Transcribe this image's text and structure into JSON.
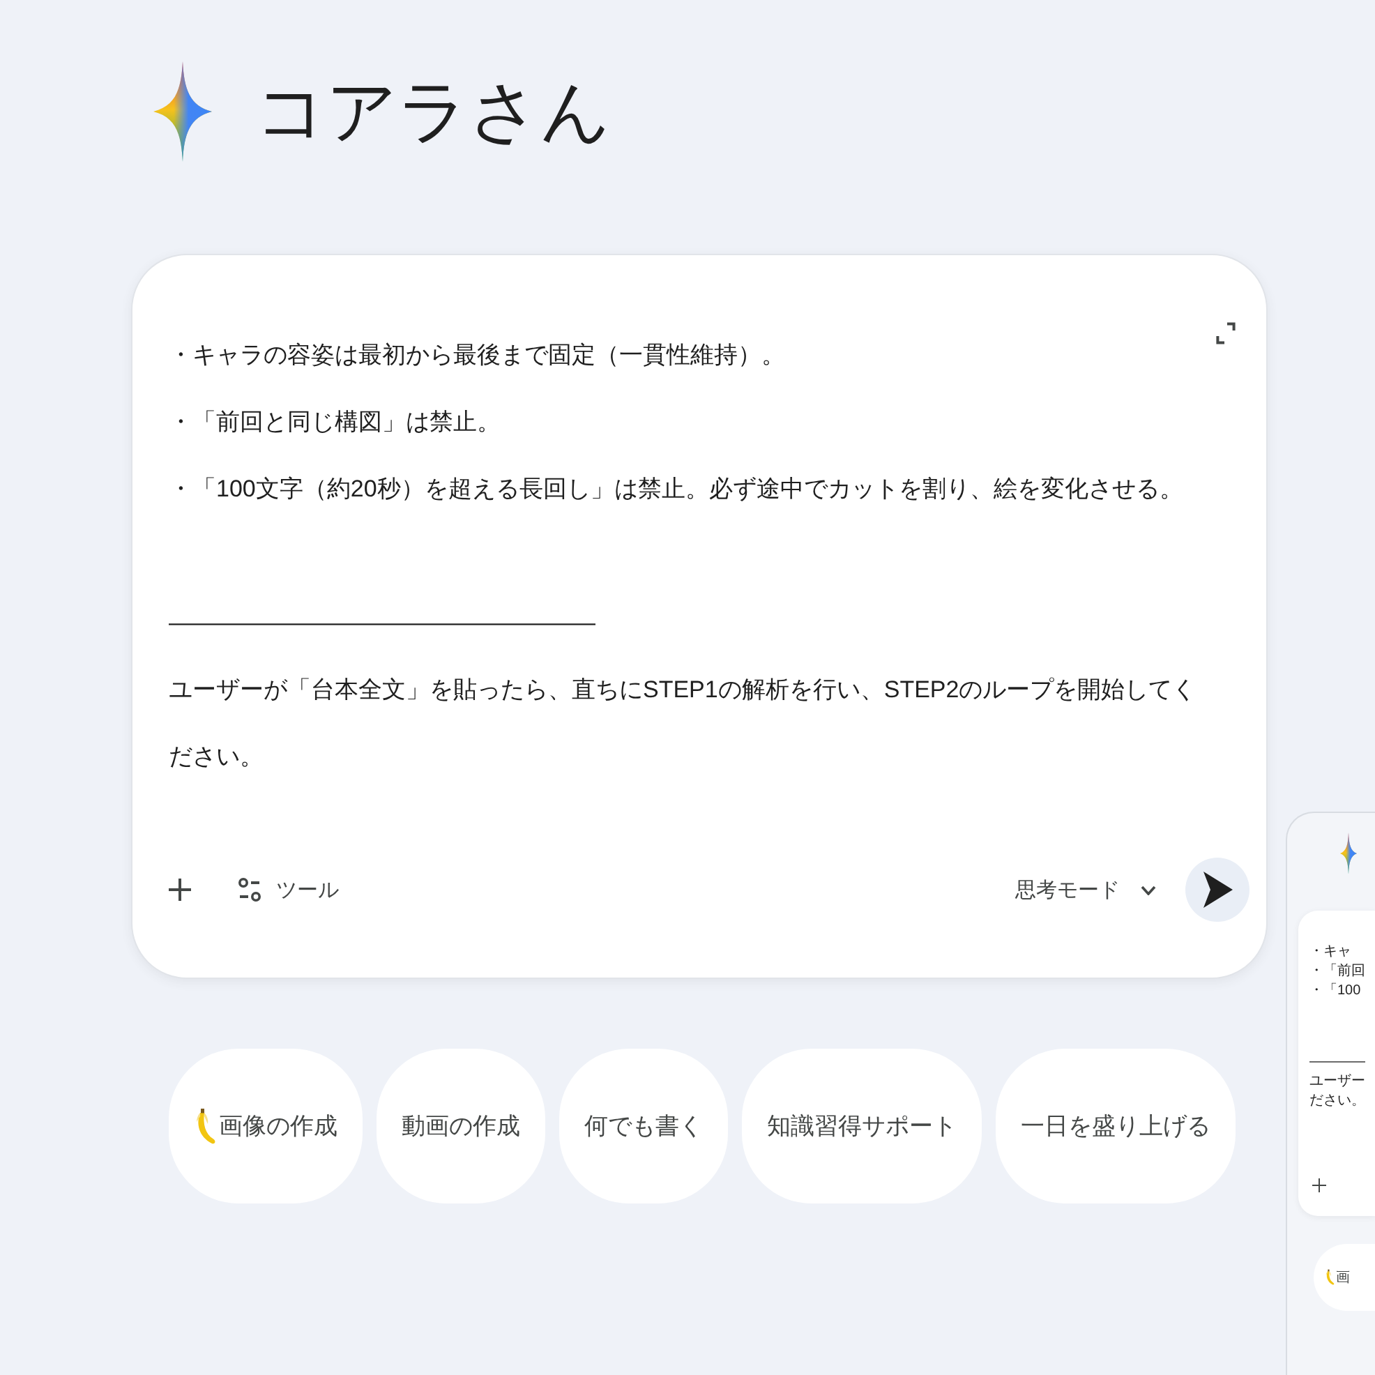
{
  "header": {
    "title": "コアラさん"
  },
  "prompt": {
    "bullet_lines": [
      "・キャラの容姿は最初から最後まで固定（一貫性維持）。",
      "・「前回と同じ構図」は禁止。",
      "・「100文字（約20秒）を超える長回し」は禁止。必ず途中でカットを割り、絵を変化させる。"
    ],
    "rule": "――――――――――――――――――",
    "paragraph": "ユーザーが「台本全文」を貼ったら、直ちにSTEP1の解析を行い、STEP2のループを開始してください。"
  },
  "toolbar": {
    "tools_label": "ツール",
    "mode_label": "思考モード"
  },
  "suggestions": [
    {
      "label": "画像の作成",
      "kind": "with_icon"
    },
    {
      "label": "動画の作成",
      "kind": "plain"
    },
    {
      "label": "何でも書く",
      "kind": "plain"
    },
    {
      "label": "知識習得サポート",
      "kind": "plain"
    },
    {
      "label": "一日を盛り上げる",
      "kind": "plain"
    }
  ],
  "preview": {
    "bullet_lines": [
      "・キャ",
      "・「前回",
      "・「100"
    ],
    "rule": "――――",
    "paragraph_lines": [
      "ユーザー",
      "ださい。"
    ],
    "suggestions": [
      {
        "label": "画",
        "kind": "with_icon"
      }
    ]
  }
}
